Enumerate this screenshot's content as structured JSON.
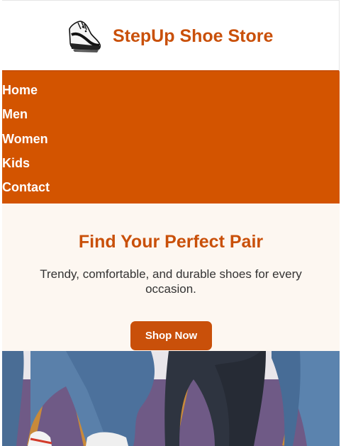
{
  "header": {
    "brand": "StepUp Shoe Store",
    "logo_icon": "sneaker-icon"
  },
  "nav": {
    "items": [
      {
        "label": "Home"
      },
      {
        "label": "Men"
      },
      {
        "label": "Women"
      },
      {
        "label": "Kids"
      },
      {
        "label": "Contact"
      }
    ]
  },
  "hero": {
    "title": "Find Your Perfect Pair",
    "subtitle": "Trendy, comfortable, and durable shoes for every occasion.",
    "cta_label": "Shop Now"
  },
  "colors": {
    "brand": "#c9500a",
    "nav_bg": "#d35400",
    "hero_bg": "#fdf7f1",
    "text": "#333333"
  }
}
